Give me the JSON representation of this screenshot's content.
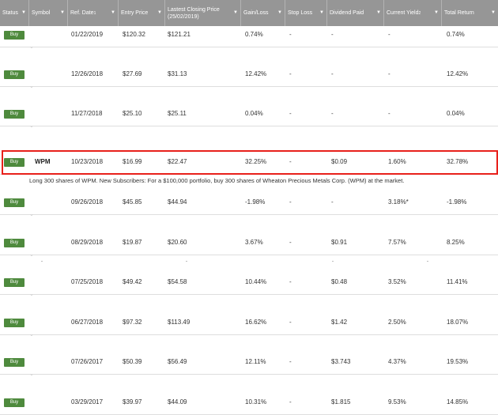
{
  "header": {
    "columns": [
      {
        "label": "Status",
        "sup": ""
      },
      {
        "label": "Symbol",
        "sup": ""
      },
      {
        "label": "Ref. Date",
        "sup": "1"
      },
      {
        "label": "Entry Price",
        "sup": ""
      },
      {
        "label": "Lastest Closing Price (25/02/2019)",
        "sup": ""
      },
      {
        "label": "Gain/Loss",
        "sup": ""
      },
      {
        "label": "Stop Loss",
        "sup": ""
      },
      {
        "label": "Dividend Paid",
        "sup": ""
      },
      {
        "label": "Current Yield",
        "sup": "2"
      },
      {
        "label": "Total Return",
        "sup": ""
      }
    ],
    "sort_caret": "▼"
  },
  "rows": [
    {
      "status": "Buy",
      "symbol": "",
      "ref_date": "01/22/2019",
      "entry": "$120.32",
      "closing": "$121.21",
      "gain": "0.74%",
      "stop": "-",
      "dividend": "-",
      "yield": "-",
      "total": "0.74%"
    },
    {
      "status": "Buy",
      "symbol": "",
      "ref_date": "12/26/2018",
      "entry": "$27.69",
      "closing": "$31.13",
      "gain": "12.42%",
      "stop": "-",
      "dividend": "-",
      "yield": "-",
      "total": "12.42%"
    },
    {
      "status": "Buy",
      "symbol": "",
      "ref_date": "11/27/2018",
      "entry": "$25.10",
      "closing": "$25.11",
      "gain": "0.04%",
      "stop": "-",
      "dividend": "-",
      "yield": "-",
      "total": "0.04%"
    },
    {
      "status": "Buy",
      "symbol": "WPM",
      "ref_date": "10/23/2018",
      "entry": "$16.99",
      "closing": "$22.47",
      "gain": "32.25%",
      "stop": "-",
      "dividend": "$0.09",
      "yield": "1.60%",
      "total": "32.78%"
    },
    {
      "status": "Buy",
      "symbol": "",
      "ref_date": "09/26/2018",
      "entry": "$45.85",
      "closing": "$44.94",
      "gain": "-1.98%",
      "stop": "-",
      "dividend": "-",
      "yield": "3.18%*",
      "total": "-1.98%"
    },
    {
      "status": "Buy",
      "symbol": "",
      "ref_date": "08/29/2018",
      "entry": "$19.87",
      "closing": "$20.60",
      "gain": "3.67%",
      "stop": "-",
      "dividend": "$0.91",
      "yield": "7.57%",
      "total": "8.25%"
    },
    {
      "status": "Buy",
      "symbol": "",
      "ref_date": "07/25/2018",
      "entry": "$49.42",
      "closing": "$54.58",
      "gain": "10.44%",
      "stop": "-",
      "dividend": "$0.48",
      "yield": "3.52%",
      "total": "11.41%"
    },
    {
      "status": "Buy",
      "symbol": "",
      "ref_date": "06/27/2018",
      "entry": "$97.32",
      "closing": "$113.49",
      "gain": "16.62%",
      "stop": "-",
      "dividend": "$1.42",
      "yield": "2.50%",
      "total": "18.07%"
    },
    {
      "status": "Buy",
      "symbol": "",
      "ref_date": "07/26/2017",
      "entry": "$50.39",
      "closing": "$56.49",
      "gain": "12.11%",
      "stop": "-",
      "dividend": "$3.743",
      "yield": "4.37%",
      "total": "19.53%"
    },
    {
      "status": "Buy",
      "symbol": "",
      "ref_date": "03/29/2017",
      "entry": "$39.97",
      "closing": "$44.09",
      "gain": "10.31%",
      "stop": "-",
      "dividend": "$1.815",
      "yield": "9.53%",
      "total": "14.85%"
    }
  ],
  "expanded_note": "Long 300 shares of WPM. New Subscribers: For a $100,000 portfolio, buy 300 shares of Wheaton Precious Metals Corp. (WPM) at the market.",
  "row_chevron": "⌄",
  "colors": {
    "header_bg": "#969696",
    "buy_green": "#4e8a3d",
    "highlight_red": "#e8201b"
  }
}
